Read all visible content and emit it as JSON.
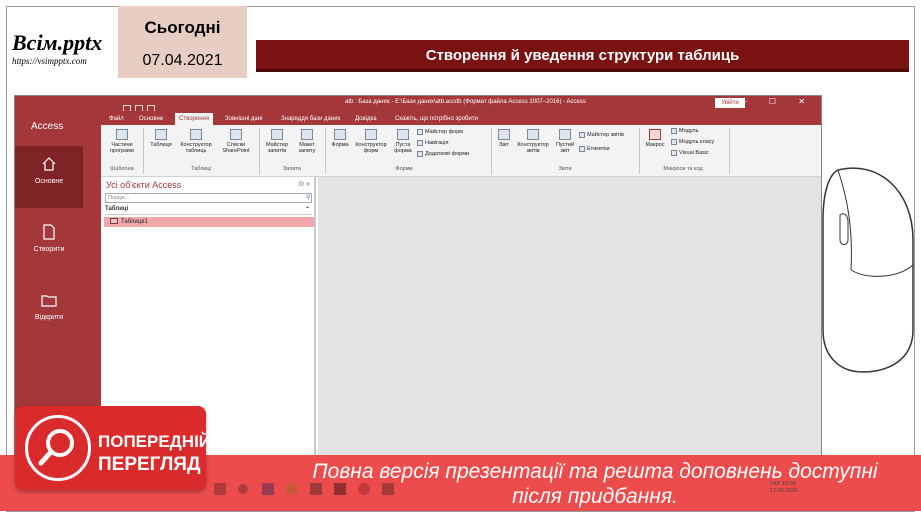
{
  "slide": {
    "logo": {
      "main": "Всім.pptx",
      "url": "https://vsimpptx.com"
    },
    "date_box": {
      "today": "Сьогодні",
      "date": "07.04.2021"
    },
    "title": "Створення й уведення структури таблиць"
  },
  "access_window": {
    "title": "atb : База даних - E:\\Бази даних\\atb.accdb (Формат файла Access 2007–2016) - Access",
    "signin": "Увійти",
    "window_controls": "– ☐ ✕",
    "tabs": [
      "Файл",
      "Основне",
      "Створення",
      "Зовнішні дані",
      "Знаряддя бази даних",
      "Довідка"
    ],
    "tell_me": "Скажіть, що потрібно зробити",
    "ribbon": {
      "templates": {
        "button": "Частини програми",
        "group": "Шаблони"
      },
      "tables": {
        "buttons": [
          "Таблиця",
          "Конструктор таблиць",
          "Списки SharePoint"
        ],
        "group": "Таблиці"
      },
      "queries": {
        "buttons": [
          "Майстер запитів",
          "Макет запиту"
        ],
        "group": "Запити"
      },
      "forms": {
        "buttons": [
          "Форма",
          "Конструктор форм",
          "Пуста форма"
        ],
        "small": [
          "Майстер форм",
          "Навігація",
          "Додаткові форми"
        ],
        "group": "Форми"
      },
      "reports": {
        "buttons": [
          "Звіт",
          "Конструктор звітів",
          "Пустий звіт"
        ],
        "small": [
          "Майстер звітів",
          "Етикетки"
        ],
        "group": "Звіти"
      },
      "macros": {
        "button": "Макрос",
        "small": [
          "Модуль",
          "Модуль класу",
          "Visual Basic"
        ],
        "group": "Макроси та код"
      }
    },
    "backstage": {
      "title": "Access",
      "items": [
        {
          "label": "Основне",
          "icon": "home-icon"
        },
        {
          "label": "Створити",
          "icon": "new-file-icon"
        },
        {
          "label": "Відкрити",
          "icon": "open-folder-icon"
        }
      ]
    },
    "nav_pane": {
      "title": "Усі об'єкти Access",
      "search_placeholder": "Пошук...",
      "group": "Таблиці",
      "items": [
        "Таблиця1"
      ]
    }
  },
  "banner": {
    "preview_line1": "ПОПЕРЕДНІЙ",
    "preview_line2": "ПЕРЕГЛЯД",
    "text": "Повна версія презентації та решта доповнень доступні після придбання."
  },
  "taskbar": {
    "lang": "УКР",
    "time": "16:06",
    "date": "17.05.2020"
  },
  "watermark": "https://vsimpptx.com",
  "colors": {
    "access_red": "#a4373a",
    "title_bar": "#7a1212",
    "banner": "#ed4c4c",
    "date_box": "#e8cdc5"
  }
}
